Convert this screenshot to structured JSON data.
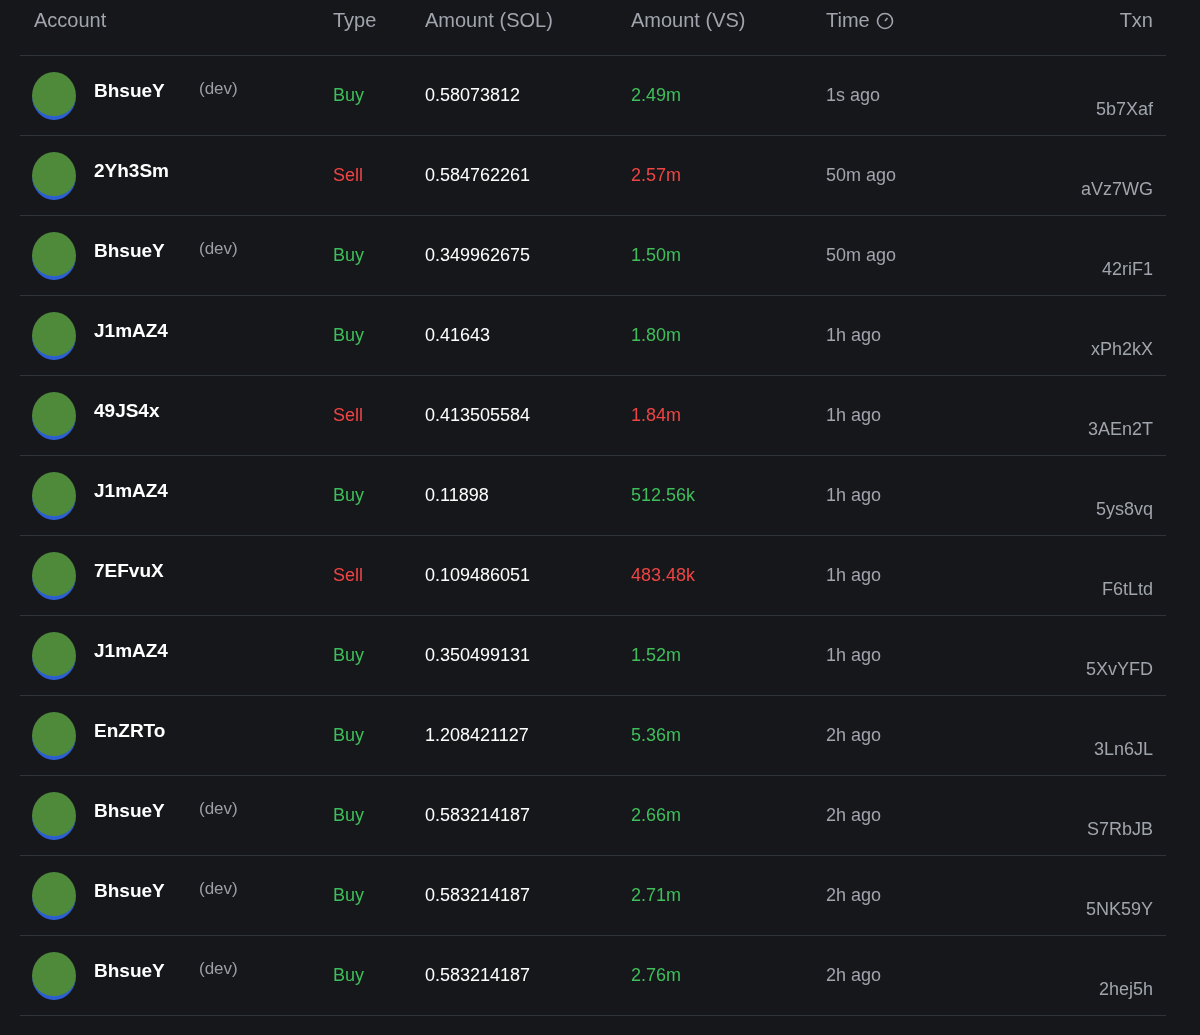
{
  "columns": [
    "Account",
    "Type",
    "Amount (SOL)",
    "Amount (VS)",
    "Time",
    "Txn"
  ],
  "rows": [
    {
      "account": "BhsueY",
      "tag": "(dev)",
      "kind": "buy",
      "type": "Buy",
      "sol": "0.58073812",
      "vs": "2.49m",
      "time": "1s ago",
      "txn": "5b7Xaf"
    },
    {
      "account": "2Yh3Sm",
      "kind": "sell",
      "type": "Sell",
      "sol": "0.584762261",
      "vs": "2.57m",
      "time": "50m ago",
      "txn": "aVz7WG"
    },
    {
      "account": "BhsueY",
      "tag": "(dev)",
      "kind": "buy",
      "type": "Buy",
      "sol": "0.349962675",
      "vs": "1.50m",
      "time": "50m ago",
      "txn": "42riF1"
    },
    {
      "account": "J1mAZ4",
      "kind": "buy",
      "type": "Buy",
      "sol": "0.41643",
      "vs": "1.80m",
      "time": "1h ago",
      "txn": "xPh2kX"
    },
    {
      "account": "49JS4x",
      "kind": "sell",
      "type": "Sell",
      "sol": "0.413505584",
      "vs": "1.84m",
      "time": "1h ago",
      "txn": "3AEn2T"
    },
    {
      "account": "J1mAZ4",
      "kind": "buy",
      "type": "Buy",
      "sol": "0.11898",
      "vs": "512.56k",
      "time": "1h ago",
      "txn": "5ys8vq"
    },
    {
      "account": "7EFvuX",
      "kind": "sell",
      "type": "Sell",
      "sol": "0.109486051",
      "vs": "483.48k",
      "time": "1h ago",
      "txn": "F6tLtd"
    },
    {
      "account": "J1mAZ4",
      "kind": "buy",
      "type": "Buy",
      "sol": "0.350499131",
      "vs": "1.52m",
      "time": "1h ago",
      "txn": "5XvYFD"
    },
    {
      "account": "EnZRTo",
      "kind": "buy",
      "type": "Buy",
      "sol": "1.208421127",
      "vs": "5.36m",
      "time": "2h ago",
      "txn": "3Ln6JL"
    },
    {
      "account": "BhsueY",
      "tag": "(dev)",
      "kind": "buy",
      "type": "Buy",
      "sol": "0.583214187",
      "vs": "2.66m",
      "time": "2h ago",
      "txn": "S7RbJB"
    },
    {
      "account": "BhsueY",
      "tag": "(dev)",
      "kind": "buy",
      "type": "Buy",
      "sol": "0.583214187",
      "vs": "2.71m",
      "time": "2h ago",
      "txn": "5NK59Y"
    },
    {
      "account": "BhsueY",
      "tag": "(dev)",
      "kind": "buy",
      "type": "Buy",
      "sol": "0.583214187",
      "vs": "2.76m",
      "time": "2h ago",
      "txn": "2hej5h"
    }
  ]
}
